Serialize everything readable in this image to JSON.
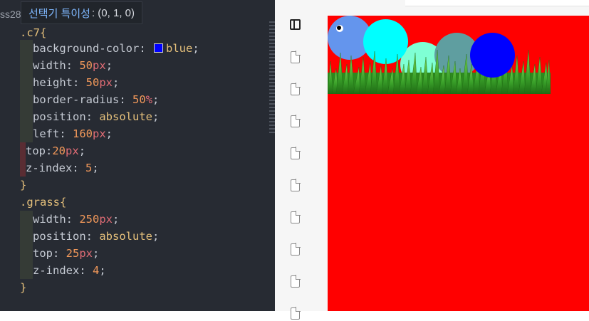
{
  "editor": {
    "tab_fragment": "ss28",
    "tooltip": {
      "title": "선택기 특이성",
      "value": ": (0, 1, 0)"
    },
    "code": {
      "c7_selector": ".c7",
      "open_brace": "{",
      "close_brace": "}",
      "bg_prop": "background-color",
      "bg_value": "blue",
      "swatch_color": "#0000ff",
      "width_prop": "width",
      "width_num": "50",
      "height_prop": "height",
      "height_num": "50",
      "radius_prop": "border-radius",
      "radius_num": "50",
      "pct": "%",
      "position_prop": "position",
      "position_value": "absolute",
      "left_prop": "left",
      "left_num": "160",
      "top_prop": "top",
      "top_num": "20",
      "z_prop": "z-index",
      "z_num_c7": "5",
      "grass_selector": ".grass",
      "grass_width_num": "250",
      "grass_top_num": "25",
      "z_num_grass": "4",
      "px": "px"
    }
  },
  "preview": {
    "stage_color": "#ff0000",
    "circles": [
      {
        "name": "caterpillar-head",
        "color": "#6495ed"
      },
      {
        "name": "caterpillar-segment-cyan",
        "color": "#00ffff"
      },
      {
        "name": "caterpillar-segment-aquamarine",
        "color": "#7fffd4"
      },
      {
        "name": "caterpillar-segment-cadetblue",
        "color": "#5f9ea0"
      },
      {
        "name": "caterpillar-segment-blue",
        "color": "#0000ff"
      }
    ]
  },
  "sidebar": {
    "icons": [
      "layout-panel-icon",
      "file-icon",
      "file-icon",
      "file-icon",
      "file-icon",
      "file-icon",
      "file-icon",
      "file-icon",
      "file-icon"
    ]
  }
}
